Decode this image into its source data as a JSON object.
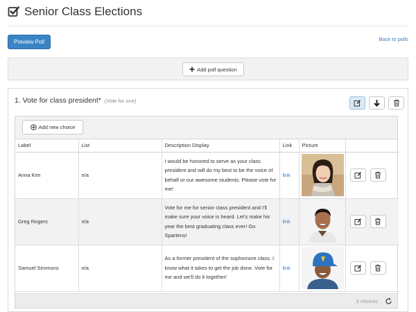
{
  "header": {
    "title": "Senior Class Elections"
  },
  "toolbar": {
    "preview_label": "Preview Poll",
    "back_label": "Back to polls"
  },
  "add_question": {
    "label": "Add poll question"
  },
  "question": {
    "title": "1. Vote for class president*",
    "hint": "(Vote for one)",
    "add_choice_label": "Add new choice",
    "columns": [
      "Label",
      "List",
      "Description Display",
      "Link",
      "Picture",
      ""
    ],
    "rows": [
      {
        "label": "Anna Kim",
        "list": "n/a",
        "description": "I would be honored to serve as your class president and will do my best to be the voice of behalf or our awesome students. Please vote for me!",
        "link": "link"
      },
      {
        "label": "Greg Rogers",
        "list": "n/a",
        "description": "Vote for me for senior class president and I'll make sure your voice is heard. Let's make his year the best graduating class ever! Go Spartens!",
        "link": "link"
      },
      {
        "label": "Samuel Simmons",
        "list": "n/a",
        "description": "As a former president of the sophomore class, I know what it takes to get the job done. Vote for me and we'll do it together!",
        "link": "link"
      }
    ],
    "footer_count": "3 choices"
  },
  "colors": {
    "primary": "#3a84c6",
    "link": "#3b7bbf",
    "panel_bg": "#f2f2f2",
    "active_btn": "#dbe8f5"
  },
  "icons": [
    "check-square-icon",
    "plus-icon",
    "plus-circle-icon",
    "edit-icon",
    "arrow-down-icon",
    "trash-icon",
    "refresh-icon"
  ]
}
